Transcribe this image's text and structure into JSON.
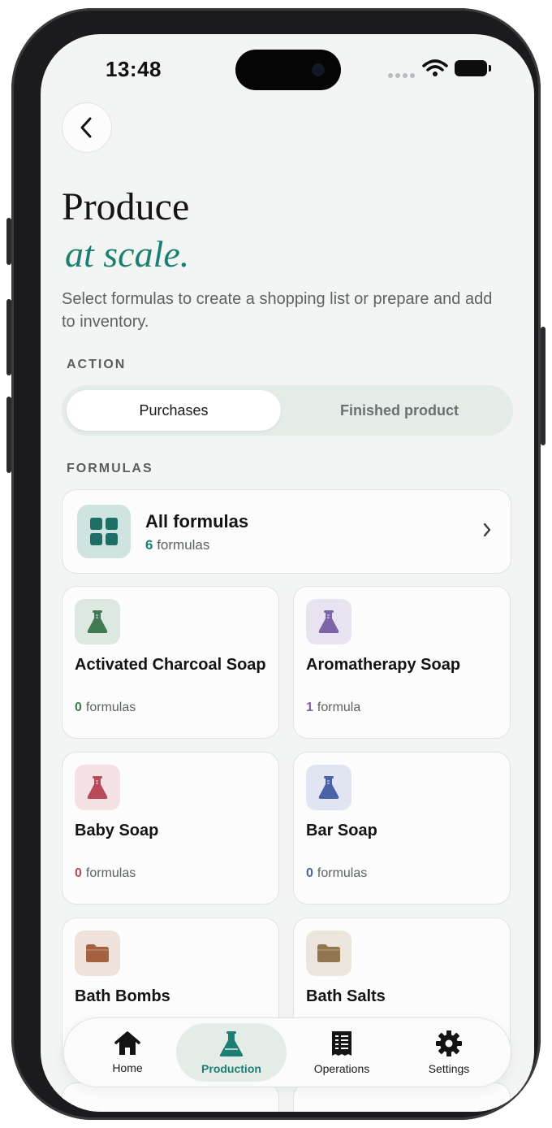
{
  "status_bar": {
    "time": "13:48"
  },
  "header": {
    "title_line1": "Produce",
    "title_line2": "at scale.",
    "subtitle": "Select formulas to create a shopping list or prepare and add to inventory."
  },
  "action": {
    "section_label": "ACTION",
    "options": [
      "Purchases",
      "Finished product"
    ],
    "selected": "Purchases"
  },
  "formulas": {
    "section_label": "FORMULAS",
    "all_card": {
      "title": "All formulas",
      "count": "6",
      "count_label": "formulas"
    },
    "categories": [
      {
        "name": "Activated Charcoal Soap",
        "count": "0",
        "count_label": "formulas",
        "color": "#3f7a52",
        "bg": "#dde8e1",
        "icon": "flask-icon"
      },
      {
        "name": "Aromatherapy Soap",
        "count": "1",
        "count_label": "formula",
        "color": "#7d64a8",
        "bg": "#e7e3f0",
        "icon": "flask-icon"
      },
      {
        "name": "Baby Soap",
        "count": "0",
        "count_label": "formulas",
        "color": "#b94a58",
        "bg": "#f3e1e4",
        "icon": "flask-icon"
      },
      {
        "name": "Bar Soap",
        "count": "0",
        "count_label": "formulas",
        "color": "#4a63a8",
        "bg": "#e1e5f1",
        "icon": "flask-icon"
      },
      {
        "name": "Bath Bombs",
        "count": "",
        "count_label": "",
        "color": "#a4613f",
        "bg": "#efe2db",
        "icon": "folder-icon"
      },
      {
        "name": "Bath Salts",
        "count": "",
        "count_label": "",
        "color": "#8f7650",
        "bg": "#ebe5db",
        "icon": "folder-icon"
      }
    ]
  },
  "nav": {
    "items": [
      {
        "label": "Home",
        "icon": "home-icon"
      },
      {
        "label": "Production",
        "icon": "flask-icon"
      },
      {
        "label": "Operations",
        "icon": "document-icon"
      },
      {
        "label": "Settings",
        "icon": "gear-icon"
      }
    ],
    "active": "Production"
  },
  "colors": {
    "accent": "#1d7f72",
    "background": "#f2f5f3"
  }
}
